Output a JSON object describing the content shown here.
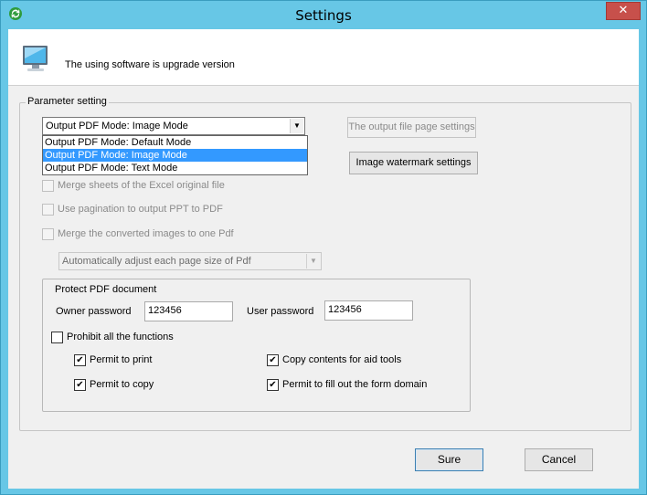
{
  "window": {
    "title": "Settings",
    "close_glyph": "✕",
    "app_icon": "refresh-icon"
  },
  "header": {
    "icon": "monitor-icon",
    "message": "The using software is upgrade version"
  },
  "parameter_group": {
    "label": "Parameter setting",
    "output_mode": {
      "value": "Output PDF Mode: Image Mode",
      "options": [
        "Output PDF Mode: Default Mode",
        "Output PDF Mode: Image Mode",
        "Output PDF Mode: Text Mode"
      ]
    },
    "page_settings_button": "The output file page settings",
    "watermark_button": "Image watermark settings",
    "merge_excel": "Merge sheets of the Excel original file",
    "ppt_pagination": "Use pagination to output PPT to PDF",
    "merge_images": "Merge the converted images to one Pdf",
    "page_size": "Automatically adjust each page size of Pdf"
  },
  "protect_group": {
    "label": "Protect PDF document",
    "owner_password_label": "Owner password",
    "owner_password_value": "123456",
    "user_password_label": "User password",
    "user_password_value": "123456",
    "prohibit_all": "Prohibit all the functions",
    "permit_print": "Permit to print",
    "permit_copy": "Permit to copy",
    "copy_aid": "Copy contents for aid tools",
    "fill_form": "Permit to fill out the form domain",
    "check_glyph": "✔"
  },
  "footer": {
    "ok": "Sure",
    "cancel": "Cancel"
  },
  "colors": {
    "titlebar": "#67c7e6",
    "close": "#c7504b",
    "selection": "#3399ff"
  }
}
